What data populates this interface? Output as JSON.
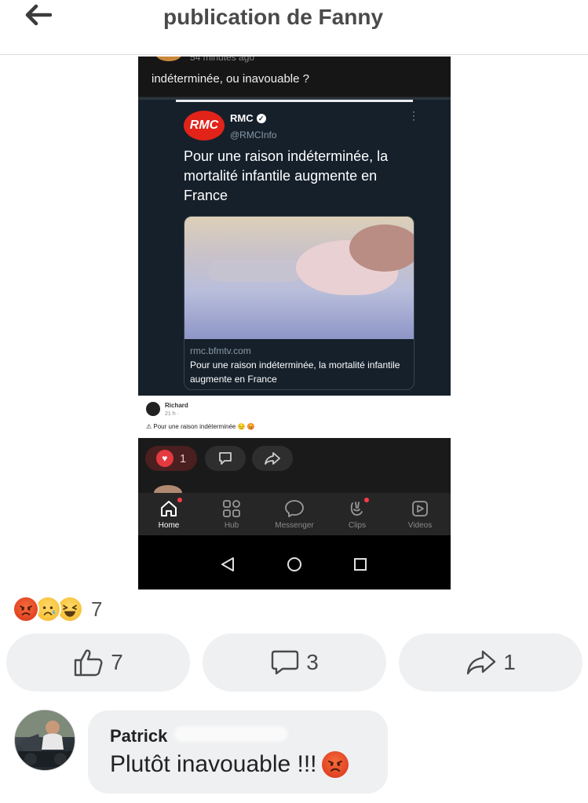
{
  "header": {
    "title": "publication de Fanny"
  },
  "screenshot": {
    "caption": "indéterminée, ou inavouable ?",
    "partial_time": "54 minutes ago",
    "tweet": {
      "logo_text": "RMC",
      "name": "RMC",
      "handle": "@RMCInfo",
      "more": "⋮",
      "text": "Pour une raison indéterminée, la mortalité infantile augmente en France",
      "card_domain": "rmc.bfmtv.com",
      "card_title": "Pour une raison indéterminée, la mortalité infantile augmente en France"
    },
    "fb_post": {
      "name": "Richard",
      "time": "21 h · ",
      "text": "⚠ Pour une raison indéterminée 😔 😡"
    },
    "action_bar": {
      "like_count": "1"
    },
    "bottom_nav": [
      {
        "label": "Home",
        "active": true
      },
      {
        "label": "Hub",
        "active": false
      },
      {
        "label": "Messenger",
        "active": false
      },
      {
        "label": "Clips",
        "active": false
      },
      {
        "label": "Videos",
        "active": false
      }
    ]
  },
  "reactions": {
    "emojis": [
      "angry",
      "sad",
      "laugh"
    ],
    "count": "7"
  },
  "actions": {
    "like_count": "7",
    "comment_count": "3",
    "share_count": "1"
  },
  "comment": {
    "author": "Patrick",
    "text": "Plutôt inavouable !!!"
  }
}
